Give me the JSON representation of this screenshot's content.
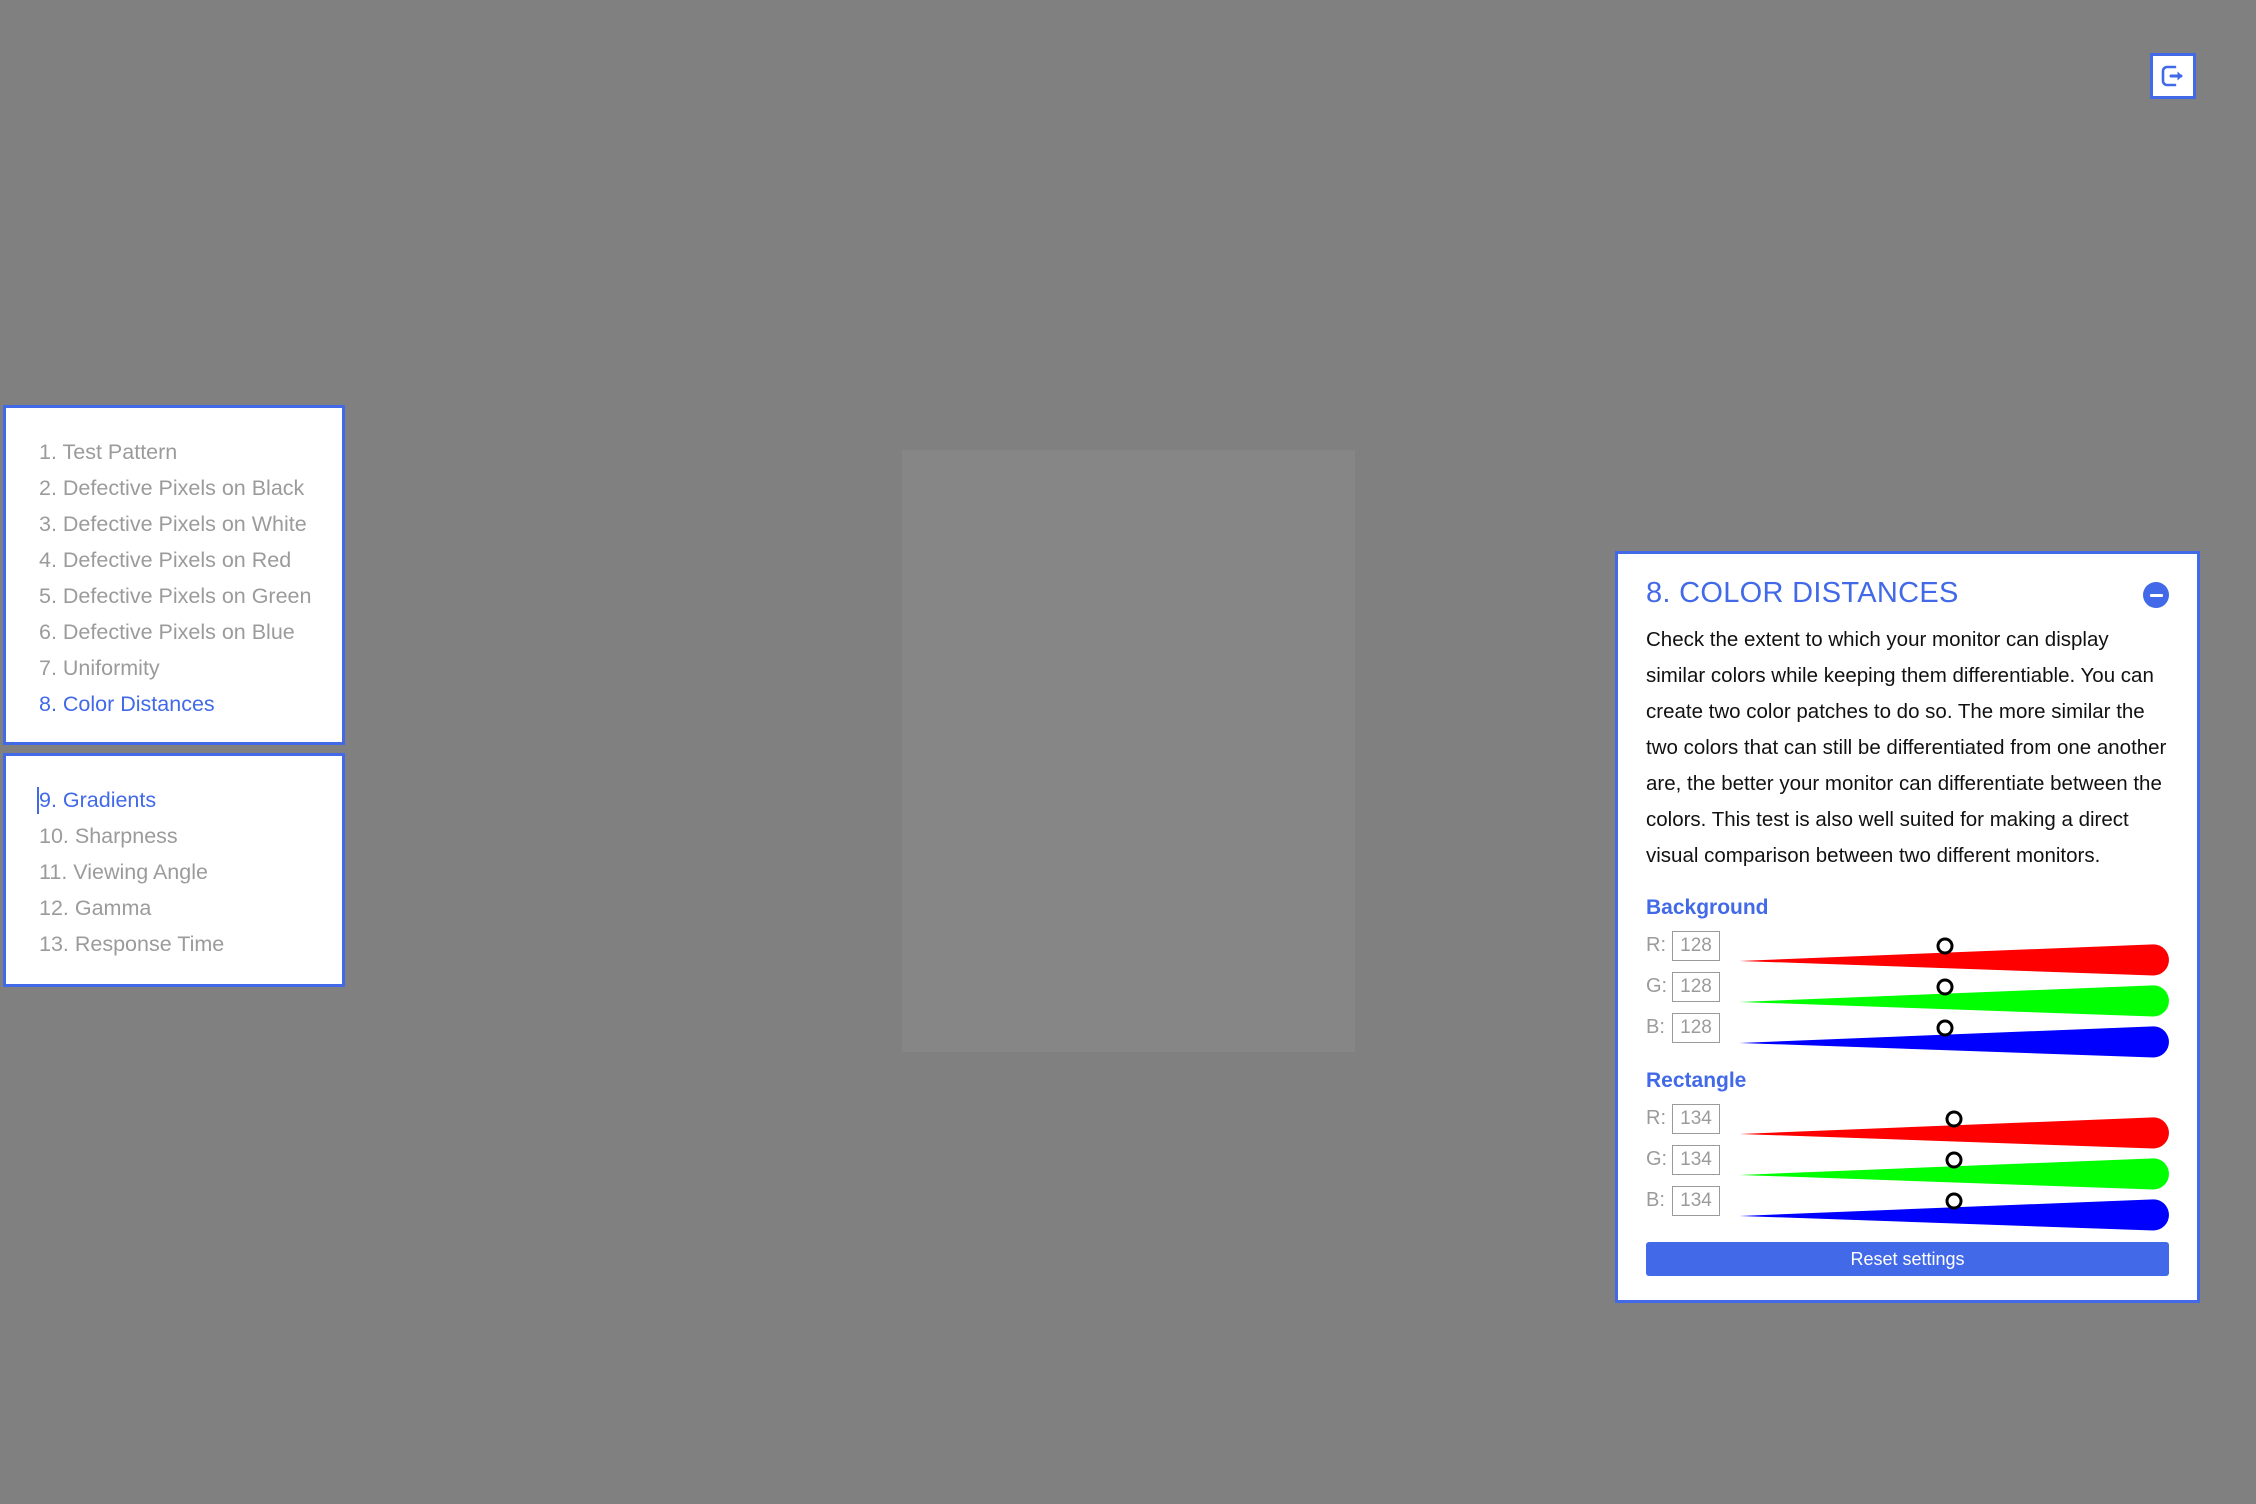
{
  "background_color": "#808080",
  "accent_color": "#4169e8",
  "topbar": {
    "exit_icon": "exit-arrow-icon"
  },
  "color_patch": {
    "name": "rectangle-color-patch",
    "fill": "#868686"
  },
  "nav": {
    "primary": [
      {
        "label": "1. Test Pattern",
        "active": false
      },
      {
        "label": "2. Defective Pixels on Black",
        "active": false
      },
      {
        "label": "3. Defective Pixels on White",
        "active": false
      },
      {
        "label": "4. Defective Pixels on Red",
        "active": false
      },
      {
        "label": "5. Defective Pixels on Green",
        "active": false
      },
      {
        "label": "6. Defective Pixels on Blue",
        "active": false
      },
      {
        "label": "7. Uniformity",
        "active": false
      },
      {
        "label": "8. Color Distances",
        "active": true
      }
    ],
    "secondary": [
      {
        "label": "9. Gradients",
        "active": true,
        "caret": true
      },
      {
        "label": "10. Sharpness",
        "active": false
      },
      {
        "label": "11. Viewing Angle",
        "active": false
      },
      {
        "label": "12. Gamma",
        "active": false
      },
      {
        "label": "13. Response Time",
        "active": false
      }
    ]
  },
  "panel": {
    "title": "8. COLOR DISTANCES",
    "collapse_icon": "minus-circle-icon",
    "description": "Check the extent to which your monitor can display similar colors while keeping them differentiable. You can create two color patches to do so. The more similar the two colors that can still be differentiated from one another are, the better your monitor can differentiate between the colors. This test is also well suited for making a direct visual comparison between two different monitors.",
    "groups": [
      {
        "label": "Background",
        "channels": [
          {
            "letter": "R:",
            "value": "128",
            "color": "#ff0000",
            "max": 255
          },
          {
            "letter": "G:",
            "value": "128",
            "color": "#00ff00",
            "max": 255
          },
          {
            "letter": "B:",
            "value": "128",
            "color": "#0000ff",
            "max": 255
          }
        ]
      },
      {
        "label": "Rectangle",
        "channels": [
          {
            "letter": "R:",
            "value": "134",
            "color": "#ff0000",
            "max": 255
          },
          {
            "letter": "G:",
            "value": "134",
            "color": "#00ff00",
            "max": 255
          },
          {
            "letter": "B:",
            "value": "134",
            "color": "#0000ff",
            "max": 255
          }
        ]
      }
    ],
    "reset_label": "Reset settings"
  }
}
